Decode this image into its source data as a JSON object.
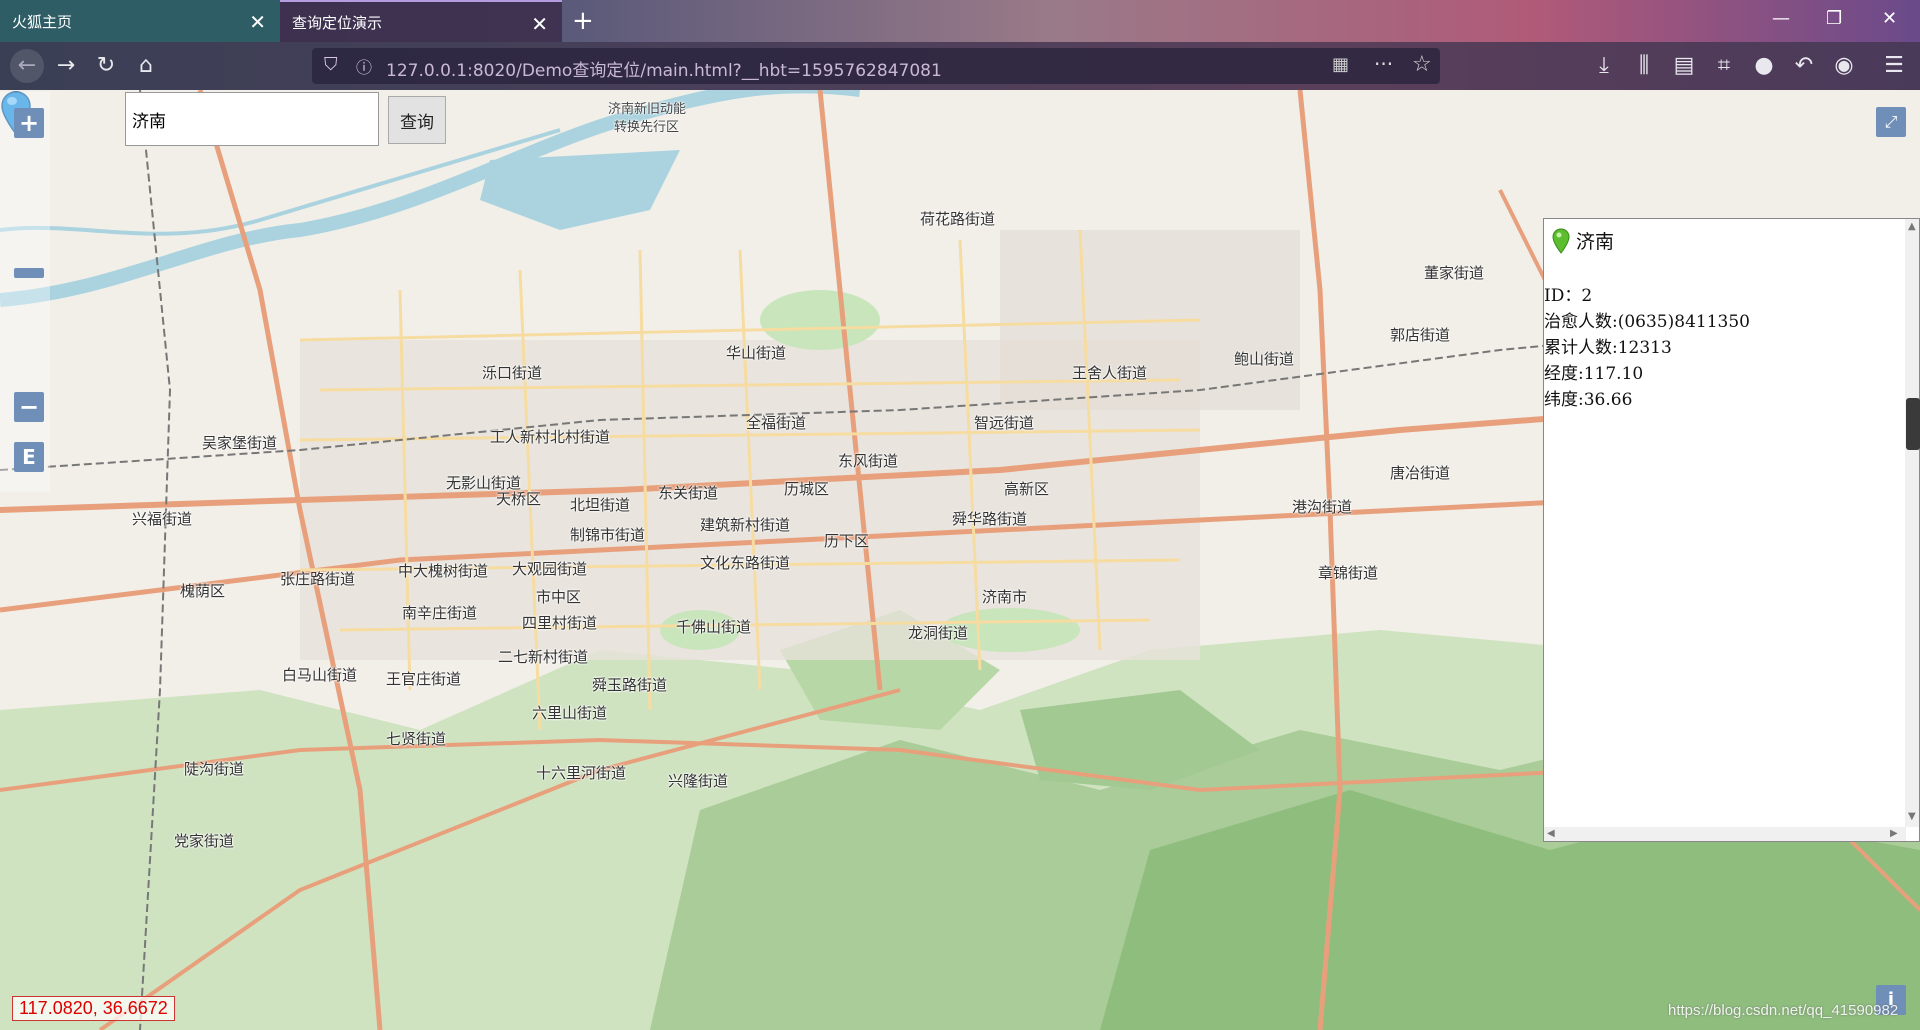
{
  "browser": {
    "tabs": [
      {
        "label": "火狐主页",
        "active": false
      },
      {
        "label": "查询定位演示",
        "active": true
      }
    ],
    "url": "127.0.0.1:8020/Demo查询定位/main.html?__hbt=1595762847081"
  },
  "search": {
    "value": "济南",
    "button_label": "查询"
  },
  "map_controls": {
    "zoom_in": "+",
    "zoom_out": "−",
    "layer_switch": "E"
  },
  "map_labels": [
    "济南新旧动能",
    "转换先行区",
    "荷花路街道",
    "华山街道",
    "泺口街道",
    "全福街道",
    "东风街道",
    "历城区",
    "天桥区",
    "北坦街道",
    "东关街道",
    "建筑新村街道",
    "历下区",
    "制锦市街道",
    "文化东路街道",
    "舜华路街道",
    "高新区",
    "王舍人街道",
    "鲍山街道",
    "郭店街道",
    "唐冶街道",
    "港沟街道",
    "章锦街道",
    "济南市",
    "龙洞街道",
    "千佛山街道",
    "四里村街道",
    "市中区",
    "大观园街道",
    "中大槐树街道",
    "张庄路街道",
    "槐荫区",
    "南辛庄街道",
    "二七新村街道",
    "舜玉路街道",
    "六里山街道",
    "十六里河街道",
    "兴隆街道",
    "七贤街道",
    "白马山街道",
    "王官庄街道",
    "陡沟街道",
    "党家街道",
    "吴家堡街道",
    "无影山街道",
    "兴福街道",
    "工人新村北村街道",
    "智远街道",
    "董家街道"
  ],
  "popup": {
    "title": "济南",
    "lines": [
      "ID：2",
      "治愈人数:(0635)8411350",
      "累计人数:12313",
      "经度:117.10",
      "纬度:36.66"
    ]
  },
  "coordinates_readout": "117.0820, 36.6672",
  "watermark": "https://blog.csdn.net/qq_41590982",
  "colors": {
    "map_bg": "#f2efe9",
    "primary_road": "#e8a07c",
    "secondary_road": "#f6dca0",
    "water": "#aad3df",
    "park": "#c8e5bb",
    "forest": "#a0c890",
    "control": "#6f8fb8",
    "marker": "#1a8fe0"
  }
}
